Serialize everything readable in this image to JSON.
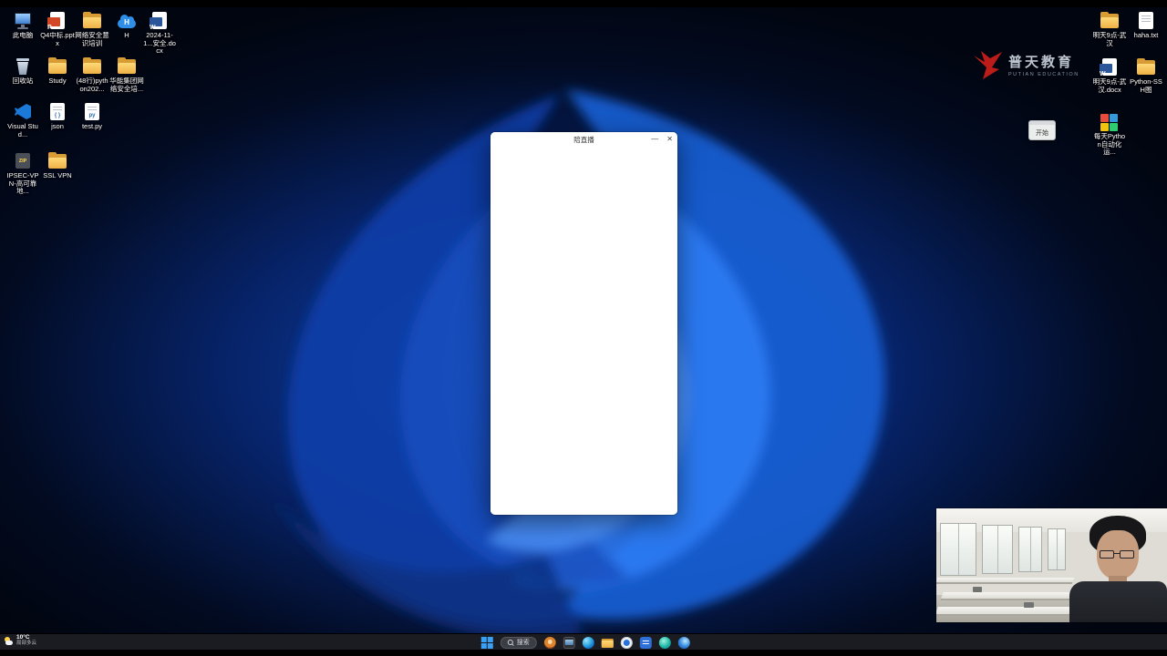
{
  "colors": {
    "taskbar_bg": "#1b1c21",
    "accent_blue": "#2f7df6",
    "folder_yellow": "#f3b950",
    "word_blue": "#2b579a",
    "ppt_red": "#d24726",
    "logo_red": "#cc1f1a",
    "window_bg": "#ffffff"
  },
  "window": {
    "title": "陪直播",
    "minimize_glyph": "—",
    "close_glyph": "✕"
  },
  "brand": {
    "title": "普天教育",
    "subtitle": "PUTIAN EDUCATION"
  },
  "start_widget": {
    "label": "开始"
  },
  "desktop": {
    "left_icons": [
      {
        "label": "此电脑",
        "type": "pc"
      },
      {
        "label": "Q4中标.pptx",
        "type": "pptx",
        "glyph": "P"
      },
      {
        "label": "网络安全意识培训",
        "type": "folder"
      },
      {
        "label": "H",
        "type": "cloud",
        "glyph": "H"
      },
      {
        "label": "2024-11-1...安全.docx",
        "type": "word",
        "glyph": "W"
      },
      {
        "label": "回收站",
        "type": "recycle"
      },
      {
        "label": "Study",
        "type": "folder"
      },
      {
        "label": "(48行)python202...",
        "type": "folder"
      },
      {
        "label": "华能集团网络安全培...",
        "type": "folder"
      },
      {
        "label": "Visual Stud...",
        "type": "vscode"
      },
      {
        "label": "json",
        "type": "json",
        "glyph": "{ }"
      },
      {
        "label": "test.py",
        "type": "py",
        "glyph": "py"
      },
      {
        "label": "IPSEC-VPN-高可靠地...",
        "type": "zip",
        "glyph": "ZIP"
      },
      {
        "label": "SSL VPN",
        "type": "folder"
      }
    ],
    "right_icons": [
      {
        "label": "明天9点-武汉",
        "type": "folder"
      },
      {
        "label": "haha.txt",
        "type": "txt"
      },
      {
        "label": "明天9点-武汉.docx",
        "type": "word",
        "glyph": "W"
      },
      {
        "label": "Python-SSH图",
        "type": "folder"
      },
      {
        "label": "每天Python自动化运...",
        "type": "colorful"
      }
    ]
  },
  "taskbar": {
    "weather": {
      "temp": "10°C",
      "condition": "局部多云"
    },
    "icons": [
      {
        "name": "start-button"
      },
      {
        "name": "search-box",
        "label": "搜索"
      },
      {
        "name": "food-app"
      },
      {
        "name": "screen-share-app"
      },
      {
        "name": "edge-browser"
      },
      {
        "name": "file-explorer"
      },
      {
        "name": "web-browser"
      },
      {
        "name": "docs-app"
      },
      {
        "name": "media-app"
      },
      {
        "name": "edge-active"
      }
    ]
  }
}
